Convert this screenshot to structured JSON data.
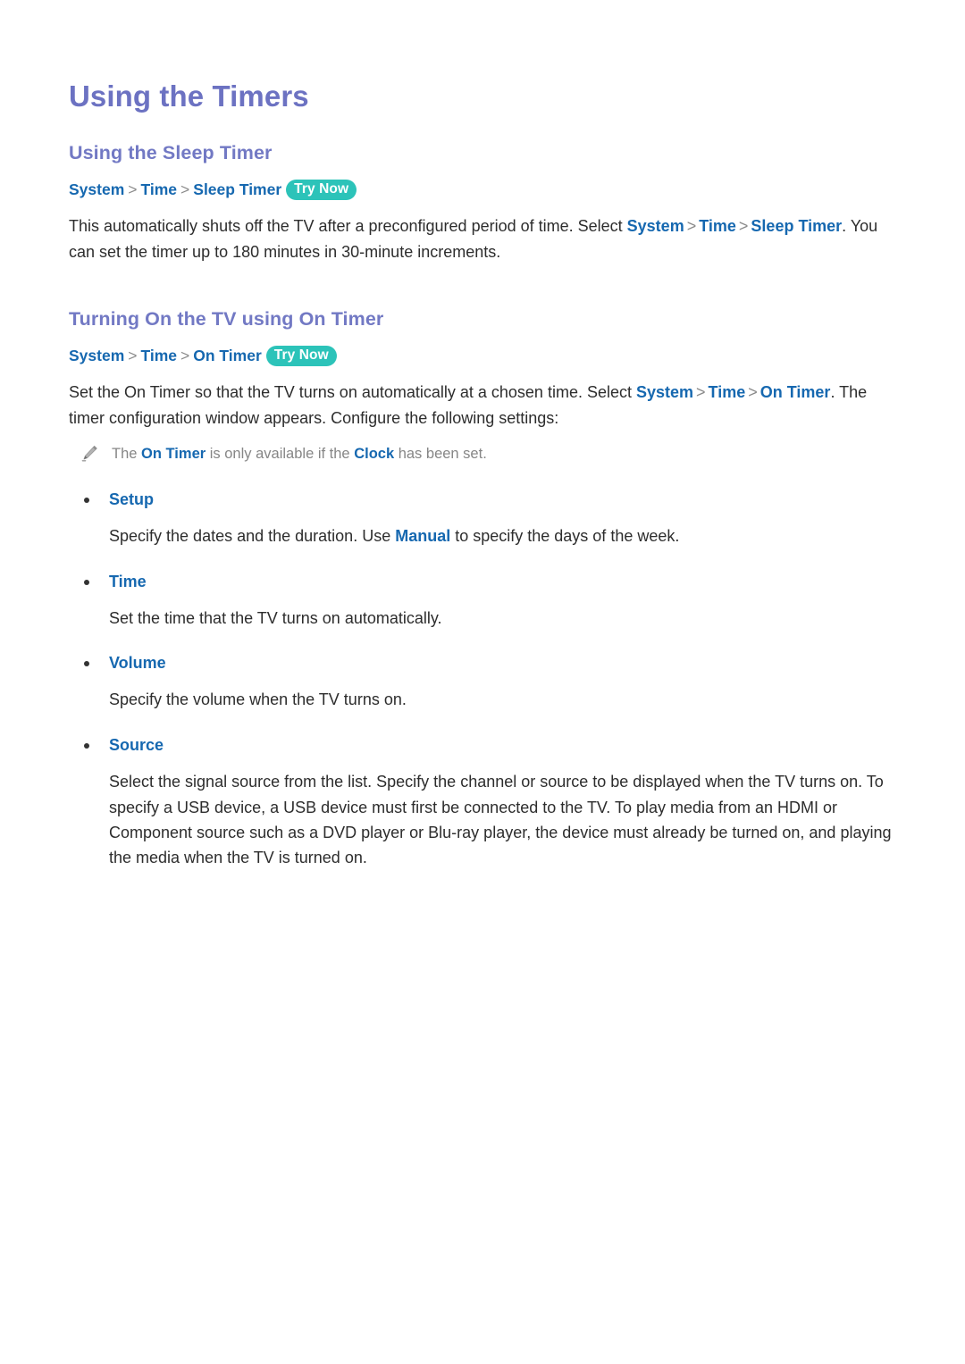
{
  "page": {
    "title": "Using the Timers"
  },
  "icons": {
    "pencil": "pencil-icon",
    "bullet": "bullet-dot-icon"
  },
  "colors": {
    "title_purple": "#6c72c2",
    "heading_purple": "#7279c4",
    "link_blue": "#1668b0",
    "badge_teal": "#2cc3b9",
    "body_text": "#2d2d2d",
    "note_text": "#868686",
    "separator_gray": "#8a8a8a"
  },
  "sections": [
    {
      "heading": "Using the Sleep Timer",
      "breadcrumb": {
        "items": [
          "System",
          "Time",
          "Sleep Timer"
        ],
        "separator": ">",
        "badge": "Try Now"
      },
      "paragraph": {
        "p1": "This automatically shuts off the TV after a preconfigured period of time. Select ",
        "link1": "System",
        "sep1": ">",
        "link2": "Time",
        "sep2": ">",
        "link3": "Sleep Timer",
        "p2": ". You can set the timer up to 180 minutes in 30-minute increments."
      }
    },
    {
      "heading": "Turning On the TV using On Timer",
      "breadcrumb": {
        "items": [
          "System",
          "Time",
          "On Timer"
        ],
        "separator": ">",
        "badge": "Try Now"
      },
      "paragraph": {
        "p1": "Set the On Timer so that the TV turns on automatically at a chosen time. Select ",
        "link1": "System",
        "sep1": ">",
        "link2": "Time",
        "sep2": ">",
        "link3": "On Timer",
        "p2": ". The timer configuration window appears. Configure the following settings:"
      },
      "note": {
        "pre": "The ",
        "link1": "On Timer",
        "mid": " is only available if the ",
        "link2": "Clock",
        "post": " has been set."
      },
      "bullets": [
        {
          "label": "Setup",
          "desc_pre": "Specify the dates and the duration. Use ",
          "desc_link": "Manual",
          "desc_post": " to specify the days of the week."
        },
        {
          "label": "Time",
          "desc_pre": "Set the time that the TV turns on automatically.",
          "desc_link": "",
          "desc_post": ""
        },
        {
          "label": "Volume",
          "desc_pre": "Specify the volume when the TV turns on.",
          "desc_link": "",
          "desc_post": ""
        },
        {
          "label": "Source",
          "desc_pre": "Select the signal source from the list. Specify the channel or source to be displayed when the TV turns on. To specify a USB device, a USB device must first be connected to the TV. To play media from an HDMI or Component source such as a DVD player or Blu-ray player, the device must already be turned on, and playing the media when the TV is turned on.",
          "desc_link": "",
          "desc_post": ""
        }
      ]
    }
  ]
}
